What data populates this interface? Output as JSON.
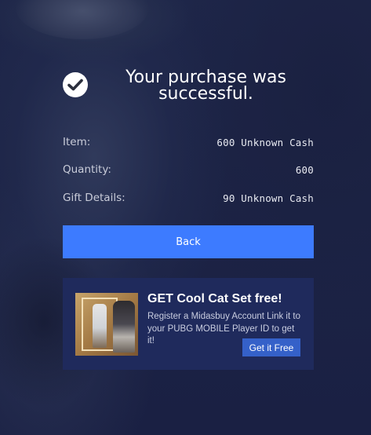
{
  "header": {
    "title": "Your purchase was successful.",
    "status_icon": "check-circle-icon"
  },
  "details": [
    {
      "label": "Item:",
      "value": "600 Unknown Cash"
    },
    {
      "label": "Quantity:",
      "value": "600"
    },
    {
      "label": "Gift Details:",
      "value": "90 Unknown Cash"
    }
  ],
  "back_button": {
    "label": "Back"
  },
  "promo": {
    "title": "GET Cool Cat Set free!",
    "text": "Register a Midasbuy Account Link it to your PUBG MOBILE Player ID to get it!",
    "button": "Get it Free"
  },
  "colors": {
    "background": "#1c2447",
    "accent": "#3d7bff",
    "promo_panel": "#1f2a5c",
    "promo_button": "#3561c9"
  }
}
